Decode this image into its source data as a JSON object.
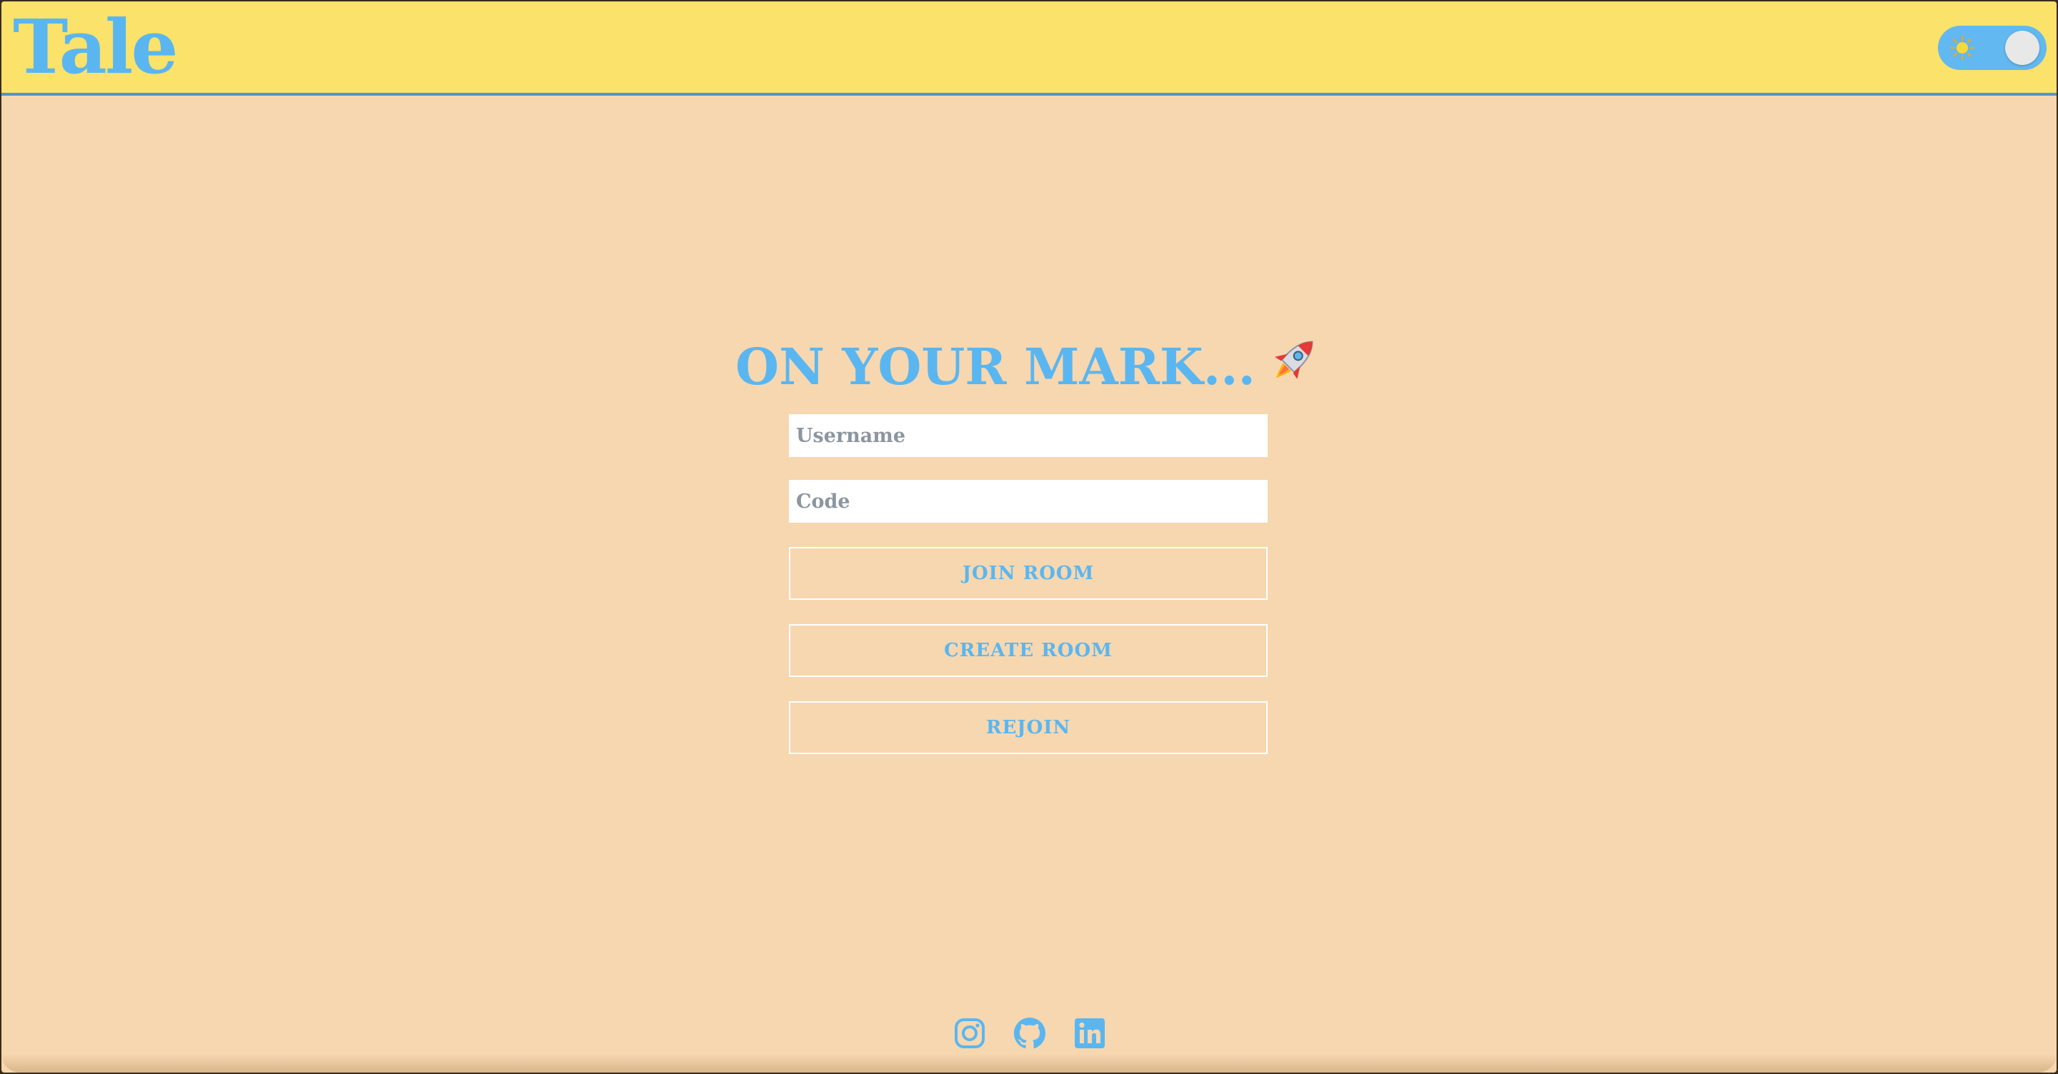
{
  "app": {
    "logo": "Tale"
  },
  "theme_toggle": {
    "icon": "sun-icon",
    "state": "light"
  },
  "form": {
    "title": "ON YOUR MARK...",
    "title_icon": "rocket-icon",
    "username_placeholder": "Username",
    "username_value": "",
    "code_placeholder": "Code",
    "code_value": "",
    "join_label": "JOIN ROOM",
    "create_label": "CREATE ROOM",
    "rejoin_label": "REJOIN"
  },
  "footer": {
    "links": [
      "instagram-icon",
      "github-icon",
      "linkedin-icon"
    ]
  },
  "colors": {
    "background": "#f7d7b0",
    "header": "#fbe26a",
    "accent": "#5ab6f0",
    "header_border": "#5a8fd0"
  }
}
